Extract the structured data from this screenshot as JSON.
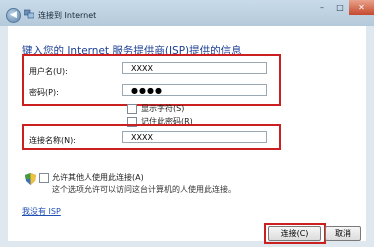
{
  "window": {
    "title": "连接到 Internet",
    "back_glyph": "◀",
    "min_glyph": "–",
    "max_glyph": "□",
    "close_glyph": "✕"
  },
  "heading": "键入您的 Internet 服务提供商(ISP)提供的信息",
  "form": {
    "username_label": "用户名(U):",
    "username_value": "XXXX",
    "password_label": "密码(P):",
    "password_value": "●●●●",
    "show_chars_label": "显示字符(S)",
    "remember_password_label": "记住此密码(R)",
    "connection_name_label": "连接名称(N):",
    "connection_name_value": "XXXX"
  },
  "allow_others": {
    "label": "允许其他人使用此连接(A)",
    "description": "这个选项允许可以访问这台计算机的人使用此连接。"
  },
  "no_isp_link": "我没有 ISP",
  "buttons": {
    "connect": "连接(C)",
    "cancel": "取消"
  },
  "colors": {
    "heading": "#1c3f94",
    "highlight": "#cc2020",
    "link": "#1f4fb5"
  }
}
